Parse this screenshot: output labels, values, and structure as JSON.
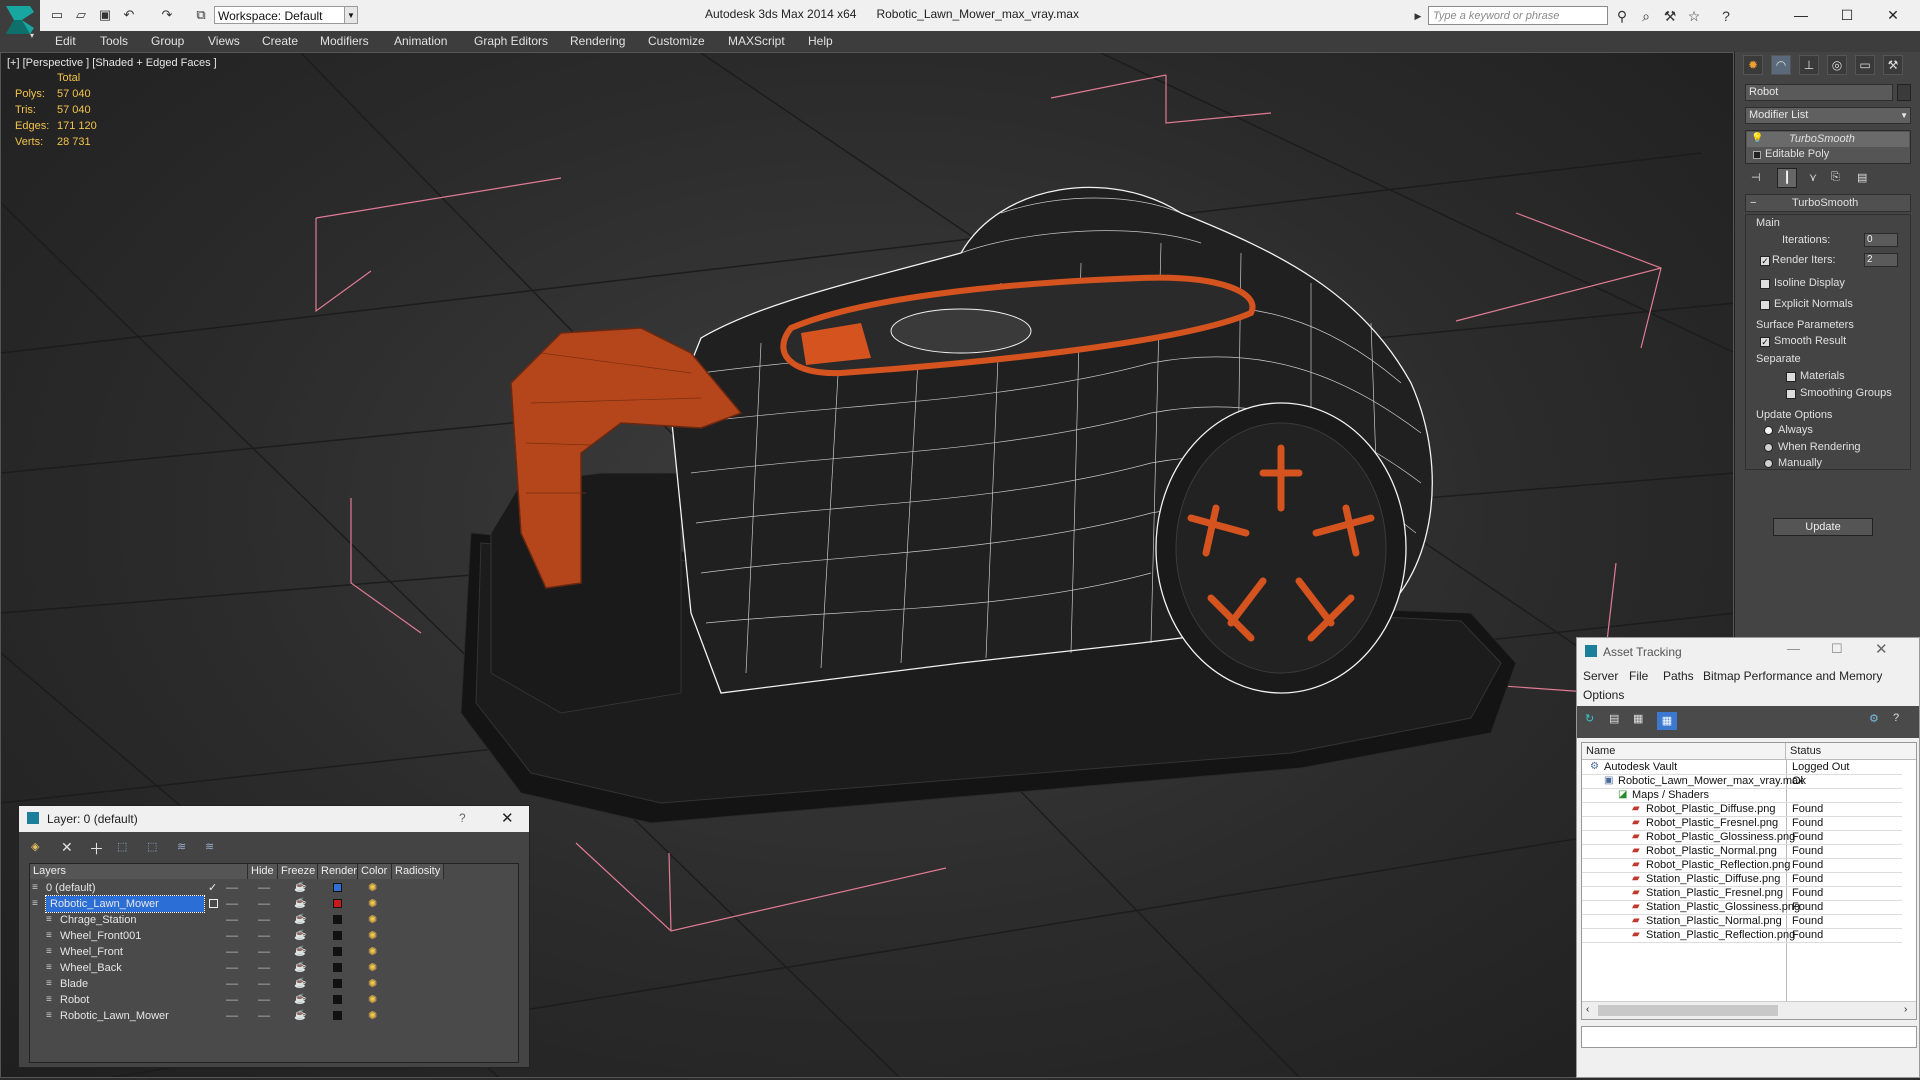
{
  "app": {
    "title": "Autodesk 3ds Max  2014 x64",
    "file": "Robotic_Lawn_Mower_max_vray.max",
    "workspace": "Workspace: Default",
    "search_placeholder": "Type a keyword or phrase"
  },
  "menu": [
    "Edit",
    "Tools",
    "Group",
    "Views",
    "Create",
    "Modifiers",
    "Animation",
    "Graph Editors",
    "Rendering",
    "Customize",
    "MAXScript",
    "Help"
  ],
  "viewport": {
    "label": "[+] [Perspective ] [Shaded + Edged Faces ]",
    "stats": {
      "header": "Total",
      "rows": [
        {
          "label": "Polys:",
          "value": "57 040"
        },
        {
          "label": "Tris:",
          "value": "57 040"
        },
        {
          "label": "Edges:",
          "value": "171 120"
        },
        {
          "label": "Verts:",
          "value": "28 731"
        }
      ]
    }
  },
  "command_panel": {
    "object_name": "Robot",
    "modifier_list": "Modifier List",
    "stack": [
      "TurboSmooth",
      "Editable Poly"
    ],
    "rollout_title": "TurboSmooth",
    "main_label": "Main",
    "iterations_label": "Iterations:",
    "iterations_value": "0",
    "render_iters_label": "Render Iters:",
    "render_iters_value": "2",
    "isoline": "Isoline Display",
    "explicit_normals": "Explicit Normals",
    "surface_params": "Surface Parameters",
    "smooth_result": "Smooth Result",
    "separate": "Separate",
    "materials": "Materials",
    "smoothing_groups": "Smoothing Groups",
    "update_options": "Update Options",
    "always": "Always",
    "when_rendering": "When Rendering",
    "manually": "Manually",
    "update_button": "Update"
  },
  "layer_dialog": {
    "title": "Layer: 0 (default)",
    "help": "?",
    "columns": [
      "Layers",
      "Hide",
      "Freeze",
      "Render",
      "Color",
      "Radiosity"
    ],
    "rows": [
      {
        "name": "0 (default)",
        "color": "#2f6fd6",
        "indent": 1
      },
      {
        "name": "Robotic_Lawn_Mower",
        "color": "#c81a1a",
        "indent": 1,
        "selected": true
      },
      {
        "name": "Chrage_Station",
        "color": "#111111",
        "indent": 2
      },
      {
        "name": "Wheel_Front001",
        "color": "#111111",
        "indent": 2
      },
      {
        "name": "Wheel_Front",
        "color": "#111111",
        "indent": 2
      },
      {
        "name": "Wheel_Back",
        "color": "#111111",
        "indent": 2
      },
      {
        "name": "Blade",
        "color": "#111111",
        "indent": 2
      },
      {
        "name": "Robot",
        "color": "#111111",
        "indent": 2
      },
      {
        "name": "Robotic_Lawn_Mower",
        "color": "#111111",
        "indent": 2
      }
    ]
  },
  "asset_tracking": {
    "title": "Asset Tracking",
    "menu1": [
      "Server",
      "File",
      "Paths",
      "Bitmap Performance and Memory"
    ],
    "menu2": "Options",
    "col_name": "Name",
    "col_status": "Status",
    "rows": [
      {
        "name": "Autodesk Vault",
        "status": "Logged Out",
        "indent": 0
      },
      {
        "name": "Robotic_Lawn_Mower_max_vray.max",
        "status": "Ok",
        "indent": 1
      },
      {
        "name": "Maps / Shaders",
        "status": "",
        "indent": 2
      },
      {
        "name": "Robot_Plastic_Diffuse.png",
        "status": "Found",
        "indent": 3
      },
      {
        "name": "Robot_Plastic_Fresnel.png",
        "status": "Found",
        "indent": 3
      },
      {
        "name": "Robot_Plastic_Glossiness.png",
        "status": "Found",
        "indent": 3
      },
      {
        "name": "Robot_Plastic_Normal.png",
        "status": "Found",
        "indent": 3
      },
      {
        "name": "Robot_Plastic_Reflection.png",
        "status": "Found",
        "indent": 3
      },
      {
        "name": "Station_Plastic_Diffuse.png",
        "status": "Found",
        "indent": 3
      },
      {
        "name": "Station_Plastic_Fresnel.png",
        "status": "Found",
        "indent": 3
      },
      {
        "name": "Station_Plastic_Glossiness.png",
        "status": "Found",
        "indent": 3
      },
      {
        "name": "Station_Plastic_Normal.png",
        "status": "Found",
        "indent": 3
      },
      {
        "name": "Station_Plastic_Reflection.png",
        "status": "Found",
        "indent": 3
      }
    ]
  },
  "colors": {
    "accent": "#d4531f",
    "wire": "#f2f2f2",
    "bbox": "#e07b92",
    "stat_text": "#f2c34a"
  }
}
